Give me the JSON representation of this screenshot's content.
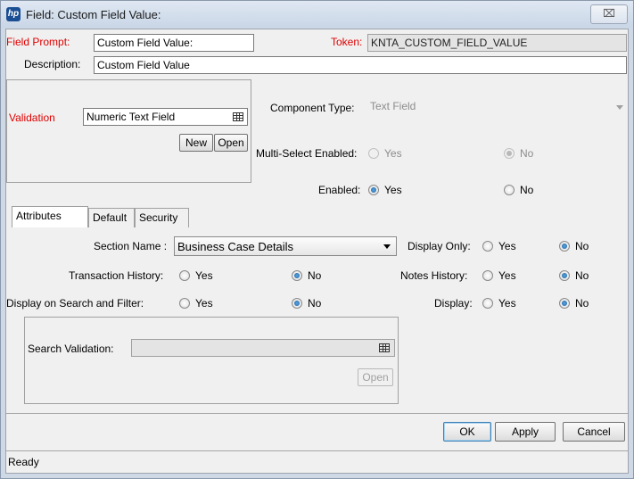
{
  "window": {
    "title": "Field: Custom Field Value:",
    "icon": "hp-logo-icon",
    "close_glyph": "⌧"
  },
  "field_prompt": {
    "label": "Field Prompt:",
    "value": "Custom Field Value:"
  },
  "token": {
    "label": "Token:",
    "value": "KNTA_CUSTOM_FIELD_VALUE"
  },
  "description": {
    "label": "Description:",
    "value": "Custom Field Value"
  },
  "validation": {
    "label": "Validation",
    "value": "Numeric Text Field",
    "new_label": "New",
    "open_label": "Open"
  },
  "component_type": {
    "label": "Component Type:",
    "value": "Text Field"
  },
  "multi_select": {
    "label": "Multi-Select Enabled:",
    "yes": "Yes",
    "no": "No",
    "selected": "No"
  },
  "enabled": {
    "label": "Enabled:",
    "yes": "Yes",
    "no": "No",
    "selected": "Yes"
  },
  "tabs": [
    {
      "label": "Attributes",
      "active": true
    },
    {
      "label": "Default",
      "active": false
    },
    {
      "label": "Security",
      "active": false
    }
  ],
  "attributes": {
    "section_name": {
      "label": "Section Name :",
      "value": "Business Case Details"
    },
    "display_only": {
      "label": "Display Only:",
      "yes": "Yes",
      "no": "No",
      "selected": "No"
    },
    "transaction_history": {
      "label": "Transaction History:",
      "yes": "Yes",
      "no": "No",
      "selected": "No"
    },
    "notes_history": {
      "label": "Notes History:",
      "yes": "Yes",
      "no": "No",
      "selected": "No"
    },
    "display_on_search": {
      "label": "Display on Search and Filter:",
      "yes": "Yes",
      "no": "No",
      "selected": "No"
    },
    "display": {
      "label": "Display:",
      "yes": "Yes",
      "no": "No",
      "selected": "No"
    },
    "search_validation": {
      "label": "Search Validation:",
      "value": "",
      "open_label": "Open"
    }
  },
  "buttons": {
    "ok": "OK",
    "apply": "Apply",
    "cancel": "Cancel"
  },
  "status": {
    "text": "Ready"
  }
}
